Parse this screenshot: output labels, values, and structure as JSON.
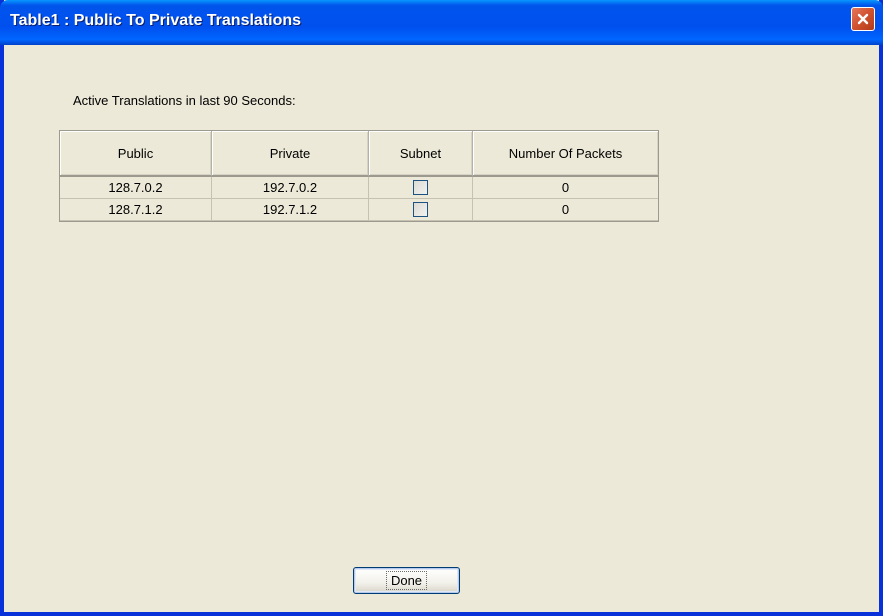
{
  "window": {
    "title": "Table1 : Public To Private Translations"
  },
  "caption": "Active Translations in last 90 Seconds:",
  "table": {
    "columns": [
      "Public",
      "Private",
      "Subnet",
      "Number Of Packets"
    ],
    "rows": [
      {
        "public": "128.7.0.2",
        "private": "192.7.0.2",
        "subnet": false,
        "packets": "0"
      },
      {
        "public": "128.7.1.2",
        "private": "192.7.1.2",
        "subnet": false,
        "packets": "0"
      }
    ]
  },
  "buttons": {
    "done_label": "Done"
  },
  "icons": {
    "close": "close-icon"
  },
  "colors": {
    "titlebar": "#0055ea",
    "window_bg": "#ece9d8",
    "close_button": "#d0522f"
  }
}
